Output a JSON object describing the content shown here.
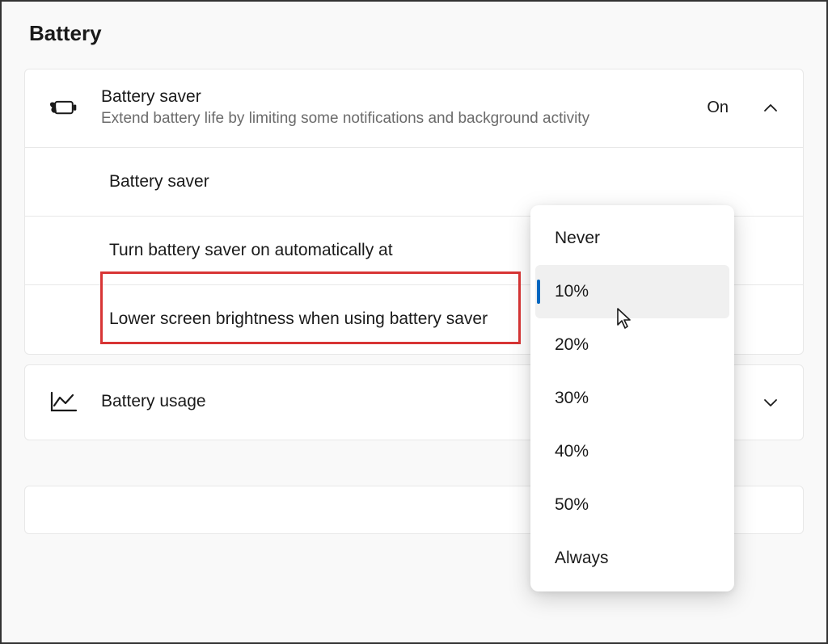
{
  "page": {
    "title": "Battery"
  },
  "battery_saver": {
    "title": "Battery saver",
    "description": "Extend battery life by limiting some notifications and background activity",
    "status": "On",
    "rows": {
      "saver_toggle": {
        "label": "Battery saver"
      },
      "auto_on": {
        "label": "Turn battery saver on automatically at"
      },
      "brightness": {
        "label": "Lower screen brightness when using battery saver"
      }
    }
  },
  "battery_usage": {
    "title": "Battery usage"
  },
  "dropdown": {
    "options": [
      "Never",
      "10%",
      "20%",
      "30%",
      "40%",
      "50%",
      "Always"
    ],
    "selected_index": 1
  }
}
